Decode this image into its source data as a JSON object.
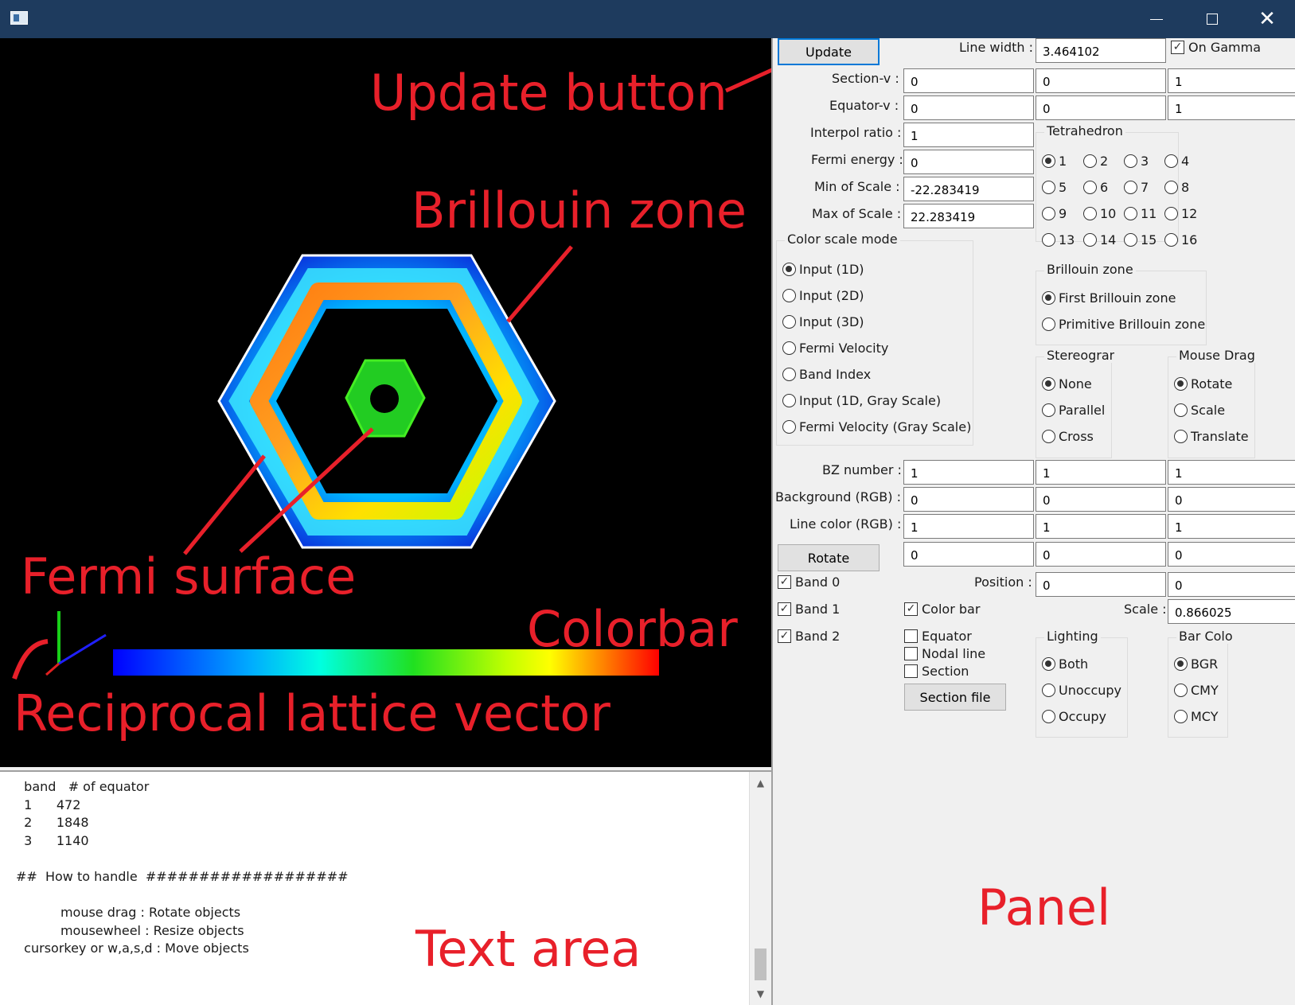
{
  "window": {
    "minimize_glyph": "",
    "close_glyph": "✕"
  },
  "viewport": {
    "annotations": {
      "update_button": "Update button",
      "brillouin_zone": "Brillouin zone",
      "fermi_surface": "Fermi surface",
      "colorbar": "Colorbar",
      "reciprocal_lattice_vector": "Reciprocal lattice vector"
    },
    "colors": {
      "annotation": "#e8202a",
      "background": "#000000",
      "bz_outline": "#ffffff"
    }
  },
  "text_area": {
    "label": "Text area",
    "lines": [
      "  band   # of equator",
      "  1      472",
      "  2      1848",
      "  3      1140",
      "",
      "##  How to handle  ###################",
      "",
      "           mouse drag : Rotate objects",
      "           mousewheel : Resize objects",
      "  cursorkey or w,a,s,d : Move objects"
    ]
  },
  "panel": {
    "label": "Panel",
    "update_button": "Update",
    "line_width_label": "Line width :",
    "line_width_value": "3.464102",
    "on_gamma_label": "On Gamma",
    "on_gamma_checked": true,
    "section_v_label": "Section-v :",
    "section_v": [
      "0",
      "0",
      "1"
    ],
    "equator_v_label": "Equator-v :",
    "equator_v": [
      "0",
      "0",
      "1"
    ],
    "interpol_label": "Interpol ratio :",
    "interpol_value": "1",
    "fermi_energy_label": "Fermi energy :",
    "fermi_energy_value": "0",
    "min_scale_label": "Min of Scale :",
    "min_scale_value": "-22.283419",
    "max_scale_label": "Max of Scale :",
    "max_scale_value": "22.283419",
    "tetrahedron": {
      "title": "Tetrahedron",
      "options": [
        "1",
        "2",
        "3",
        "4",
        "5",
        "6",
        "7",
        "8",
        "9",
        "10",
        "11",
        "12",
        "13",
        "14",
        "15",
        "16"
      ],
      "selected": "1"
    },
    "color_scale_mode": {
      "title": "Color scale mode",
      "options": [
        "Input (1D)",
        "Input (2D)",
        "Input (3D)",
        "Fermi Velocity",
        "Band Index",
        "Input (1D, Gray Scale)",
        "Fermi Velocity (Gray Scale)"
      ],
      "selected": "Input (1D)"
    },
    "brillouin_zone": {
      "title": "Brillouin zone",
      "options": [
        "First Brillouin zone",
        "Primitive Brillouin zone"
      ],
      "selected": "First Brillouin zone"
    },
    "stereogram": {
      "title": "Stereogram",
      "options": [
        "None",
        "Parallel",
        "Cross"
      ],
      "selected": "None"
    },
    "mouse_drag": {
      "title": "Mouse Drag",
      "options": [
        "Rotate",
        "Scale",
        "Translate"
      ],
      "selected": "Rotate"
    },
    "bz_number_label": "BZ number :",
    "bz_number": [
      "1",
      "1",
      "1"
    ],
    "background_label": "Background (RGB) :",
    "background": [
      "0",
      "0",
      "0"
    ],
    "line_color_label": "Line color (RGB) :",
    "line_color": [
      "1",
      "1",
      "1"
    ],
    "rotate_button": "Rotate",
    "rotate": [
      "0",
      "0",
      "0"
    ],
    "position_label": "Position :",
    "position": [
      "0",
      "0"
    ],
    "scale_label": "Scale :",
    "scale_value": "0.866025",
    "bands": [
      {
        "label": "Band 0",
        "checked": true
      },
      {
        "label": "Band 1",
        "checked": true
      },
      {
        "label": "Band 2",
        "checked": true
      }
    ],
    "color_bar_label": "Color bar",
    "color_bar_checked": true,
    "equator_label": "Equator",
    "nodal_line_label": "Nodal line",
    "section_label": "Section",
    "section_file_button": "Section file",
    "lighting": {
      "title": "Lighting",
      "options": [
        "Both",
        "Unoccupy",
        "Occupy"
      ],
      "selected": "Both"
    },
    "bar_color": {
      "title": "Bar Color",
      "options": [
        "BGR",
        "CMY",
        "MCY"
      ],
      "selected": "BGR"
    }
  }
}
